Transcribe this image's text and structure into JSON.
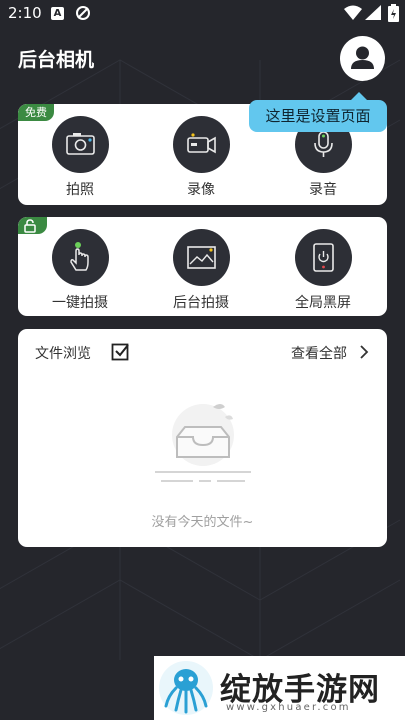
{
  "status_bar": {
    "time": "2:10",
    "notif_letter": "A"
  },
  "header": {
    "title": "后台相机"
  },
  "tooltip": {
    "text": "这里是设置页面"
  },
  "card1": {
    "tag": "免费",
    "items": [
      {
        "label": "拍照",
        "icon": "camera-icon"
      },
      {
        "label": "录像",
        "icon": "video-camera-icon"
      },
      {
        "label": "录音",
        "icon": "microphone-icon"
      }
    ]
  },
  "card2": {
    "tag_icon": "unlock-icon",
    "items": [
      {
        "label": "一键拍摄",
        "icon": "touch-hand-icon"
      },
      {
        "label": "后台拍摄",
        "icon": "image-frame-icon"
      },
      {
        "label": "全局黑屏",
        "icon": "power-screen-icon"
      }
    ]
  },
  "files": {
    "title": "文件浏览",
    "view_all": "查看全部",
    "empty_text": "没有今天的文件~"
  },
  "watermark": {
    "text": "绽放手游网",
    "url": "www.gxhuaer.com"
  },
  "colors": {
    "background": "#25262c",
    "accent_tooltip": "#62c7ee",
    "tag_green": "#3b8a42",
    "icon_circle": "#2d2f36",
    "icon_blue_dot": "#49b6e8",
    "icon_yellow_dot": "#f2c21b",
    "icon_green_dot": "#6cd05a",
    "icon_red_dot": "#e5484d"
  }
}
